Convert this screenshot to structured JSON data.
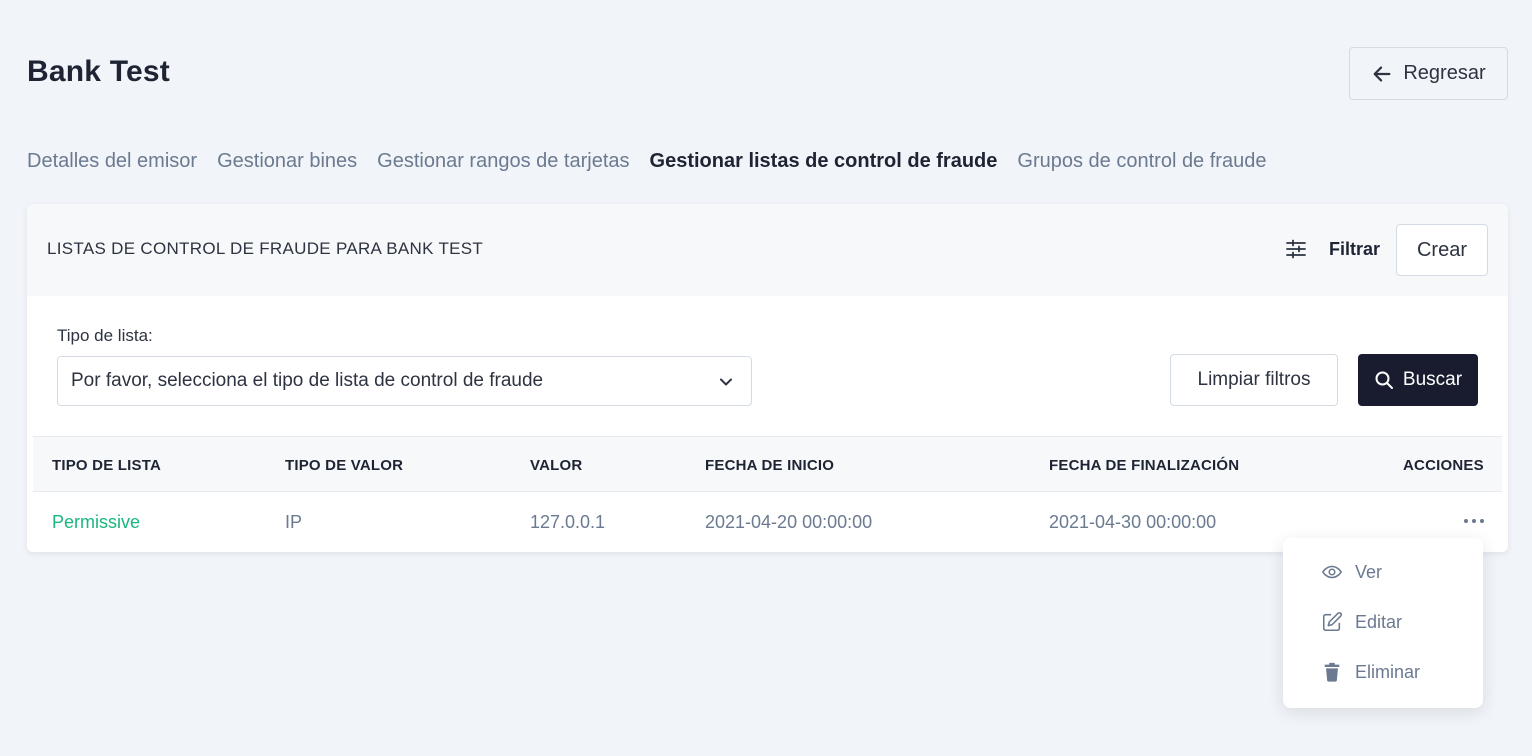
{
  "header": {
    "title": "Bank Test",
    "back_label": "Regresar"
  },
  "tabs": [
    {
      "label": "Detalles del emisor",
      "active": false
    },
    {
      "label": "Gestionar bines",
      "active": false
    },
    {
      "label": "Gestionar rangos de tarjetas",
      "active": false
    },
    {
      "label": "Gestionar listas de control de fraude",
      "active": true
    },
    {
      "label": "Grupos de control de fraude",
      "active": false
    }
  ],
  "card": {
    "title": "LISTAS DE CONTROL DE FRAUDE PARA BANK TEST",
    "filter_label": "Filtrar",
    "create_label": "Crear"
  },
  "filters": {
    "list_type_label": "Tipo de lista:",
    "list_type_value": "Por favor, selecciona el tipo de lista de control de fraude",
    "clear_label": "Limpiar filtros",
    "search_label": "Buscar"
  },
  "table": {
    "columns": [
      "TIPO DE LISTA",
      "TIPO DE VALOR",
      "VALOR",
      "FECHA DE INICIO",
      "FECHA DE FINALIZACIÓN",
      "ACCIONES"
    ],
    "rows": [
      {
        "list_type": "Permissive",
        "value_type": "IP",
        "value": "127.0.0.1",
        "start_date": "2021-04-20 00:00:00",
        "end_date": "2021-04-30 00:00:00"
      }
    ]
  },
  "actions_menu": {
    "view_label": "Ver",
    "edit_label": "Editar",
    "delete_label": "Eliminar"
  },
  "colors": {
    "page_bg": "#f1f4f8",
    "primary_dark": "#181c2e",
    "link_green": "#19b77e",
    "muted_text": "#6b7a90"
  }
}
